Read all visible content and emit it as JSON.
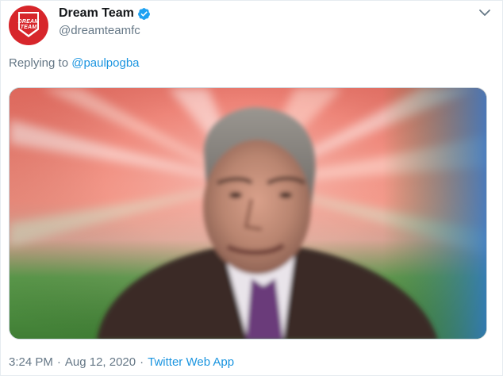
{
  "account": {
    "display_name": "Dream Team",
    "handle": "@dreamteamfc",
    "verified": true,
    "avatar_text_line1": "DREAM",
    "avatar_text_line2": "TEAM",
    "avatar_color": "#d7262b"
  },
  "reply": {
    "prefix": "Replying to",
    "mention": "@paulpogba"
  },
  "media": {
    "icon": "photo-of-man-zoom-blur"
  },
  "footer": {
    "time": "3:24 PM",
    "separator": "·",
    "date": "Aug 12, 2020",
    "source": "Twitter Web App"
  },
  "colors": {
    "link": "#1b95e0",
    "secondary_text": "#657786",
    "verified_badge": "#1da1f2"
  }
}
